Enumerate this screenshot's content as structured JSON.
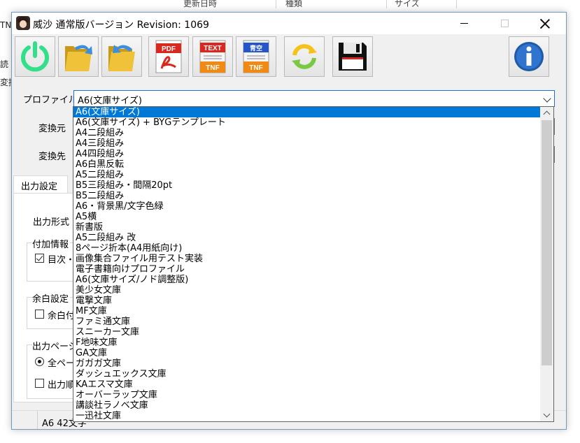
{
  "background": {
    "header_columns": [
      "更新日時",
      "種類",
      "サイズ"
    ],
    "left_fragments": [
      "TN",
      "読",
      "変換"
    ]
  },
  "window": {
    "title": "威沙 通常版バージョン Revision: 1069"
  },
  "toolbar": {
    "pdf_label": "PDF",
    "text_label": "TEXT",
    "tnf_label": "TNF",
    "aozora_label": "青空",
    "tnf_label_2": "TNF"
  },
  "form": {
    "profile_label": "プロファイル",
    "profile_value": "A6(文庫サイズ)",
    "source_label": "変換元",
    "dest_label": "変換先"
  },
  "tabs": {
    "output_settings": "出力設定"
  },
  "panel": {
    "output_format": "出力形式",
    "extra_info_group": "付加情報",
    "toc_checkbox": "目次・",
    "margin_group": "余白設定",
    "margin_checkbox": "余白付",
    "output_pages_group": "出力ページ",
    "all_pages_radio": "全ペー",
    "output_checkbox": "出力順"
  },
  "status": {
    "text": "A6 42文字"
  },
  "dropdown": {
    "selected_index": 0,
    "items": [
      "A6(文庫サイズ)",
      "A6(文庫サイズ) + BYGテンプレート",
      "A4二段組み",
      "A4三段組み",
      "A4四段組み",
      "A6白黒反転",
      "A5二段組み",
      "B5三段組み・間隔20pt",
      "B5二段組み",
      "A6・背景黒/文字色緑",
      "A5横",
      "新書版",
      "A5二段組み 改",
      "8ページ折本(A4用紙向け)",
      "画像集合ファイル用テスト実装",
      "電子書籍向けプロファイル",
      "A6(文庫サイズ/ノド調整版)",
      "美少女文庫",
      "電撃文庫",
      "MF文庫",
      "ファミ通文庫",
      "スニーカー文庫",
      "F地味文庫",
      "GA文庫",
      "ガガガ文庫",
      "ダッシュエックス文庫",
      "KAエスマ文庫",
      "オーバーラップ文庫",
      "講談社ラノベ文庫",
      "一迅社文庫"
    ]
  }
}
